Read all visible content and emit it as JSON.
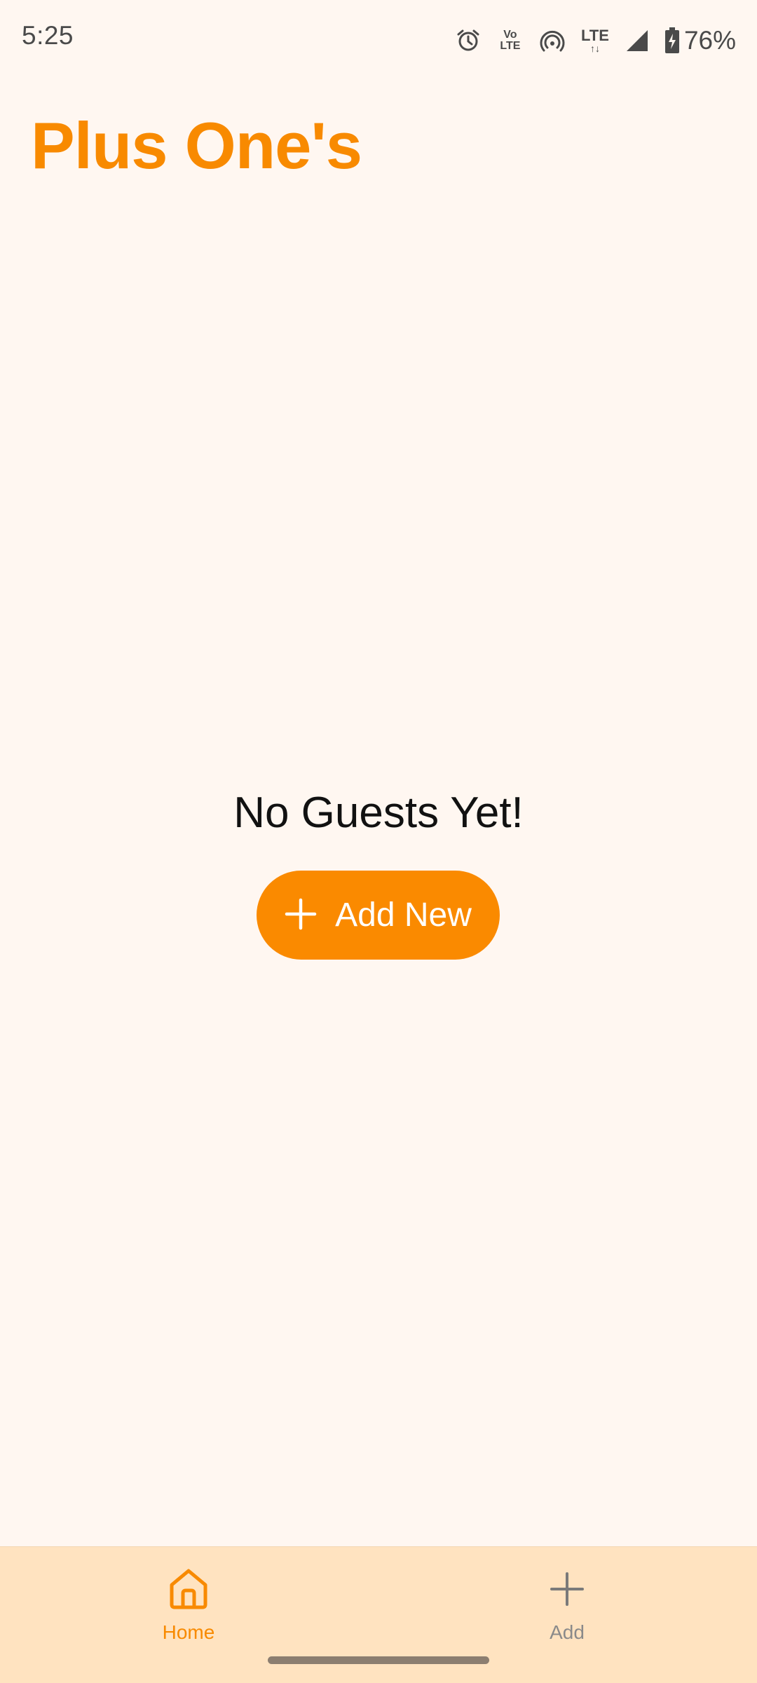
{
  "status_bar": {
    "time": "5:25",
    "volte_top": "Vo",
    "volte_bottom": "LTE",
    "network": "LTE",
    "battery": "76%",
    "icons": [
      "alarm-icon",
      "volte-icon",
      "hotspot-icon",
      "lte-icon",
      "signal-icon",
      "battery-charging-icon"
    ]
  },
  "app": {
    "title": "Plus One's",
    "accent_color": "#F88A00",
    "background_color": "#FFF7F1"
  },
  "empty_state": {
    "message": "No Guests Yet!",
    "button_label": "Add New",
    "button_icon": "plus-icon"
  },
  "bottom_nav": {
    "background_color": "#FFE3C0",
    "items": [
      {
        "label": "Home",
        "icon": "home-icon",
        "active": true
      },
      {
        "label": "Add",
        "icon": "plus-icon",
        "active": false
      }
    ]
  }
}
